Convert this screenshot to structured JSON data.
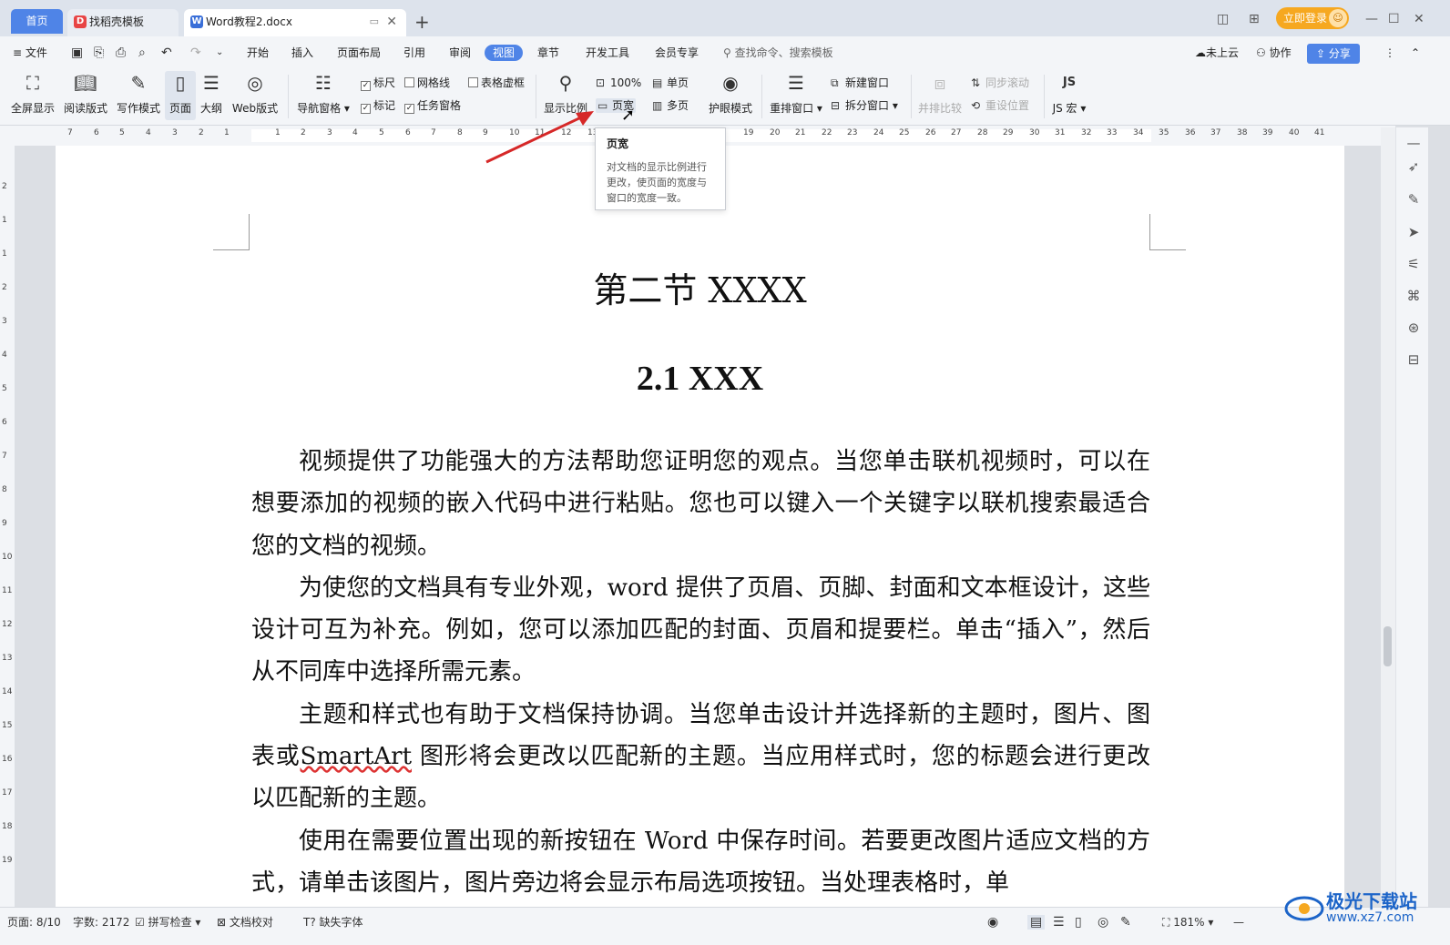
{
  "tabbar": {
    "home": "首页",
    "tabs": [
      {
        "label": "找稻壳模板"
      },
      {
        "label": "Word教程2.docx"
      }
    ],
    "add": "+",
    "login": "立即登录"
  },
  "menubar": {
    "file": "文件",
    "items": [
      "开始",
      "插入",
      "页面布局",
      "引用",
      "审阅",
      "视图",
      "章节",
      "开发工具",
      "会员专享"
    ],
    "active": "视图",
    "search_placeholder": "查找命令、搜索模板",
    "cloud": "未上云",
    "collab": "协作",
    "share": "分享"
  },
  "ribbon": {
    "fullscreen": "全屏显示",
    "reading": "阅读版式",
    "writing": "写作模式",
    "page": "页面",
    "outline": "大纲",
    "web": "Web版式",
    "nav_pane": "导航窗格",
    "ruler": "标尺",
    "gridlines": "网格线",
    "table_dashed": "表格虚框",
    "marks": "标记",
    "task_pane": "任务窗格",
    "zoom": "显示比例",
    "hundred": "100%",
    "page_width": "页宽",
    "single_page": "单页",
    "multi_page": "多页",
    "eye_mode": "护眼模式",
    "rearrange": "重排窗口",
    "new_window": "新建窗口",
    "split_window": "拆分窗口",
    "side_by_side": "并排比较",
    "sync_scroll": "同步滚动",
    "reset_pos": "重设位置",
    "js_macro": "JS 宏"
  },
  "ruler": {
    "h_ticks": [
      "7",
      "6",
      "5",
      "4",
      "3",
      "2",
      "1",
      "1",
      "2",
      "3",
      "4",
      "5",
      "6",
      "7",
      "8",
      "9",
      "10",
      "11",
      "12",
      "13",
      "19",
      "20",
      "21",
      "22",
      "23",
      "24",
      "25",
      "26",
      "27",
      "28",
      "29",
      "30",
      "31",
      "32",
      "33",
      "34",
      "35",
      "36",
      "37",
      "38",
      "39",
      "40",
      "41"
    ],
    "v_ticks": [
      "2",
      "1",
      "1",
      "2",
      "3",
      "4",
      "5",
      "6",
      "7",
      "8",
      "9",
      "10",
      "11",
      "12",
      "13",
      "14",
      "15",
      "16",
      "17",
      "18",
      "19"
    ]
  },
  "tooltip": {
    "title": "页宽",
    "desc": "对文档的显示比例进行更改，使页面的宽度与窗口的宽度一致。"
  },
  "document": {
    "heading1": "第二节  XXXX",
    "heading2": "2.1 XXX",
    "p1": "视频提供了功能强大的方法帮助您证明您的观点。当您单击联机视频时，可以在想要添加的视频的嵌入代码中进行粘贴。您也可以键入一个关键字以联机搜索最适合您的文档的视频。",
    "p2": "为使您的文档具有专业外观，word 提供了页眉、页脚、封面和文本框设计，这些设计可互为补充。例如，您可以添加匹配的封面、页眉和提要栏。单击“插入”，然后从不同库中选择所需元素。",
    "p3_a": "主题和样式也有助于文档保持协调。当您单击设计并选择新的主题时，图片、图表或",
    "p3_smart": "SmartArt",
    "p3_b": " 图形将会更改以匹配新的主题。当应用样式时，您的标题会进行更改以匹配新的主题。",
    "p4": "使用在需要位置出现的新按钮在 Word 中保存时间。若要更改图片适应文档的方式，请单击该图片，图片旁边将会显示布局选项按钮。当处理表格时，单"
  },
  "statusbar": {
    "page": "页面: 8/10",
    "words": "字数: 2172",
    "spell": "拼写检查",
    "proof": "文档校对",
    "missing_font": "缺失字体",
    "zoom": "181%"
  },
  "watermark": {
    "name": "极光下载站",
    "url": "www.xz7.com"
  },
  "colors": {
    "accent": "#4f84e7",
    "login": "#f6a820",
    "annotation_arrow": "#d62828"
  }
}
